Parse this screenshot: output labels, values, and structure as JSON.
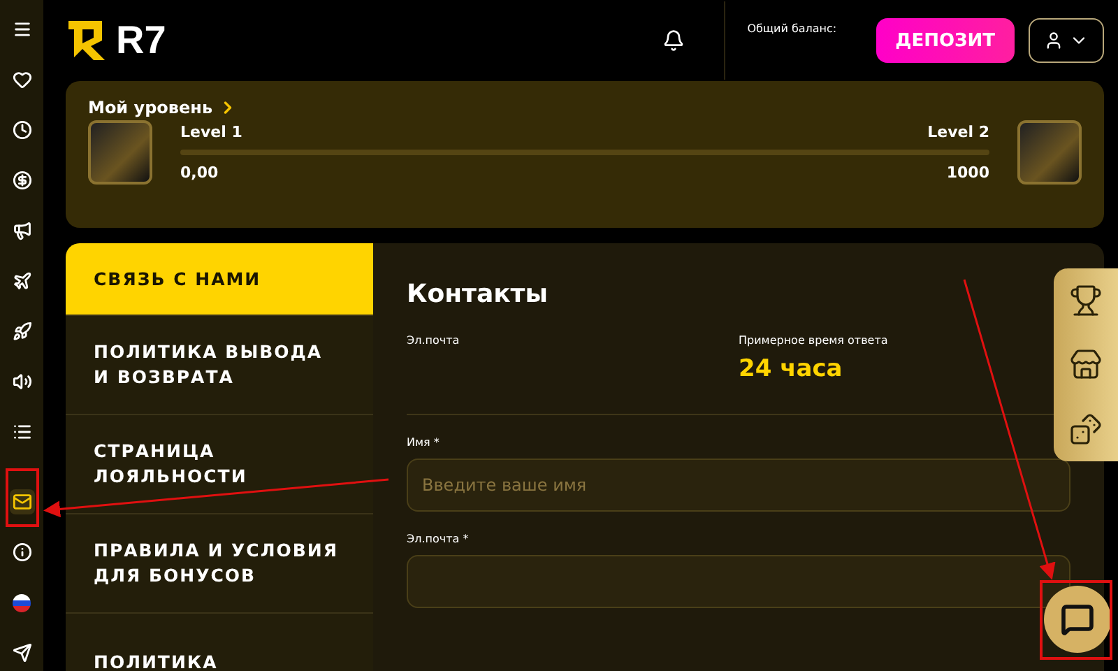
{
  "sidebar": {
    "items": [
      {
        "selected": false
      },
      {
        "selected": false
      },
      {
        "selected": false
      },
      {
        "selected": false
      },
      {
        "selected": false
      },
      {
        "selected": false
      },
      {
        "selected": false
      },
      {
        "selected": false
      },
      {
        "selected": false
      },
      {
        "selected": true
      },
      {
        "selected": false
      },
      {
        "selected": false
      },
      {
        "selected": false
      }
    ]
  },
  "header": {
    "logo": "R7",
    "balance_label": "Общий баланс:",
    "deposit_button": "ДЕПОЗИТ"
  },
  "level_card": {
    "title": "Мой уровень",
    "current_level": "Level 1",
    "next_level": "Level 2",
    "current_points": "0,00",
    "target_points": "1000",
    "level": 0
  },
  "menu": {
    "items": [
      {
        "label": "СВЯЗЬ С НАМИ",
        "selected": true
      },
      {
        "label": "ПОЛИТИКА ВЫВОДА И ВОЗВРАТА",
        "selected": false
      },
      {
        "label": "СТРАНИЦА ЛОЯЛЬНОСТИ",
        "selected": false
      },
      {
        "label": "ПРАВИЛА И УСЛОВИЯ ДЛЯ БОНУСОВ",
        "selected": false
      },
      {
        "label": "ПОЛИТИКА",
        "selected": false
      }
    ]
  },
  "contacts": {
    "title": "Контакты",
    "email_label": "Эл.почта",
    "response_label": "Примерное время ответа",
    "response_value": "24 часа",
    "fields": [
      {
        "label": "Имя *",
        "placeholder": "Введите ваше имя"
      },
      {
        "label": "Эл.почта *"
      }
    ]
  }
}
